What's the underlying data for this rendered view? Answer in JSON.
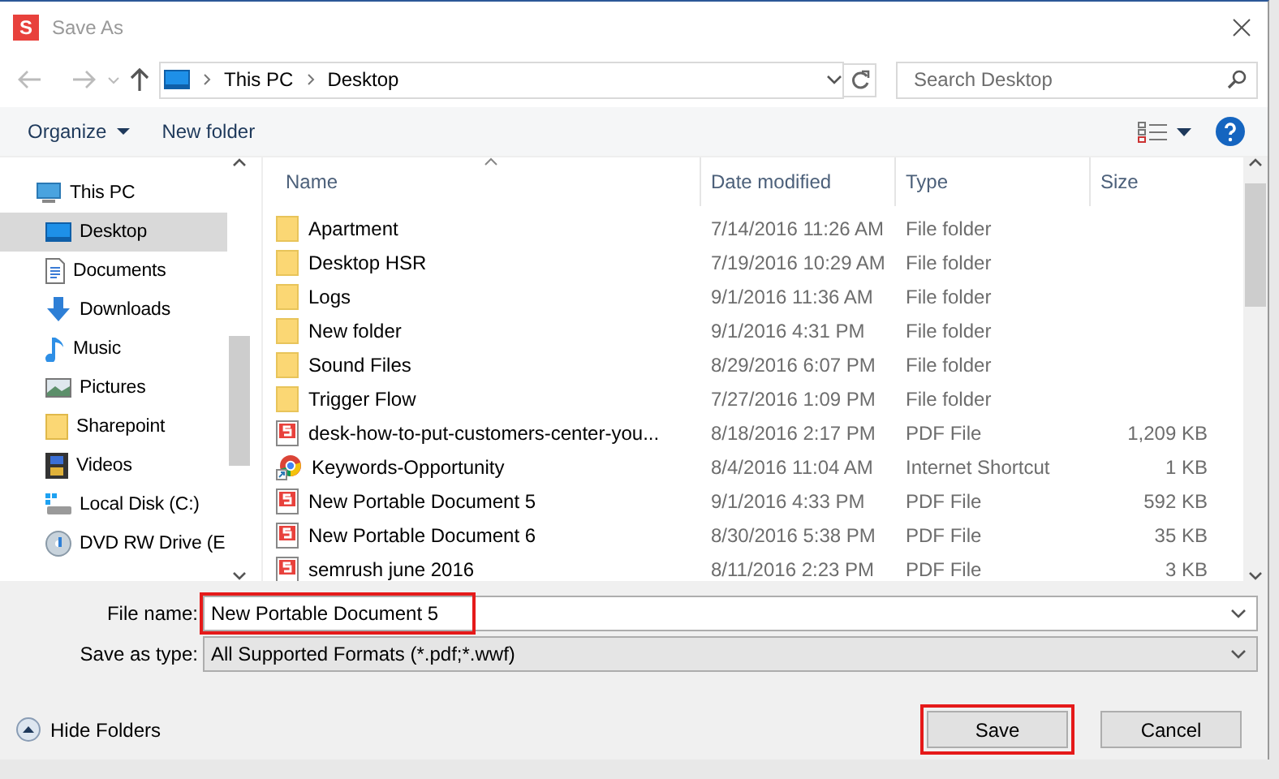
{
  "window": {
    "app_logo": "S",
    "title": "Save As"
  },
  "navigation": {
    "path": [
      "This PC",
      "Desktop"
    ],
    "search": {
      "placeholder": "Search Desktop"
    }
  },
  "toolbar": {
    "organize": "Organize",
    "new_folder": "New folder"
  },
  "sidebar": {
    "items": [
      {
        "label": "This PC",
        "kind": "pc",
        "selected": false,
        "children": [
          {
            "label": "Desktop",
            "kind": "desktop",
            "selected": true
          },
          {
            "label": "Documents",
            "kind": "documents",
            "selected": false
          },
          {
            "label": "Downloads",
            "kind": "downloads",
            "selected": false
          },
          {
            "label": "Music",
            "kind": "music",
            "selected": false
          },
          {
            "label": "Pictures",
            "kind": "pictures",
            "selected": false
          },
          {
            "label": "Sharepoint",
            "kind": "folder",
            "selected": false
          },
          {
            "label": "Videos",
            "kind": "videos",
            "selected": false
          },
          {
            "label": "Local Disk (C:)",
            "kind": "disk",
            "selected": false
          },
          {
            "label": "DVD RW Drive (E",
            "kind": "dvd",
            "selected": false
          }
        ]
      }
    ]
  },
  "table": {
    "columns": [
      "Name",
      "Date modified",
      "Type",
      "Size"
    ],
    "rows": [
      {
        "kind": "folder",
        "name": "Apartment",
        "date": "7/14/2016 11:26 AM",
        "type": "File folder",
        "size": ""
      },
      {
        "kind": "folder",
        "name": "Desktop HSR",
        "date": "7/19/2016 10:29 AM",
        "type": "File folder",
        "size": ""
      },
      {
        "kind": "folder",
        "name": "Logs",
        "date": "9/1/2016 11:36 AM",
        "type": "File folder",
        "size": ""
      },
      {
        "kind": "folder",
        "name": "New folder",
        "date": "9/1/2016 4:31 PM",
        "type": "File folder",
        "size": ""
      },
      {
        "kind": "folder",
        "name": "Sound Files",
        "date": "8/29/2016 6:07 PM",
        "type": "File folder",
        "size": ""
      },
      {
        "kind": "folder",
        "name": "Trigger Flow",
        "date": "7/27/2016 1:09 PM",
        "type": "File folder",
        "size": ""
      },
      {
        "kind": "pdf",
        "name": "desk-how-to-put-customers-center-you...",
        "date": "8/18/2016 2:17 PM",
        "type": "PDF File",
        "size": "1,209 KB"
      },
      {
        "kind": "shortcut",
        "name": "Keywords-Opportunity",
        "date": "8/4/2016 11:04 AM",
        "type": "Internet Shortcut",
        "size": "1 KB"
      },
      {
        "kind": "pdf",
        "name": "New Portable Document 5",
        "date": "9/1/2016 4:33 PM",
        "type": "PDF File",
        "size": "592 KB"
      },
      {
        "kind": "pdf",
        "name": "New Portable Document 6",
        "date": "8/30/2016 5:38 PM",
        "type": "PDF File",
        "size": "35 KB"
      },
      {
        "kind": "pdf",
        "name": "semrush june 2016",
        "date": "8/11/2016 2:23 PM",
        "type": "PDF File",
        "size": "3 KB"
      }
    ]
  },
  "form": {
    "file_name": {
      "label": "File name:",
      "value": "New Portable Document 5",
      "highlighted": true
    },
    "save_as_type": {
      "label": "Save as type:",
      "value": "All Supported Formats (*.pdf;*.wwf)"
    }
  },
  "footer": {
    "hide_folders": "Hide Folders",
    "buttons": [
      {
        "label": "Save",
        "highlighted": true
      },
      {
        "label": "Cancel",
        "highlighted": false
      }
    ]
  }
}
